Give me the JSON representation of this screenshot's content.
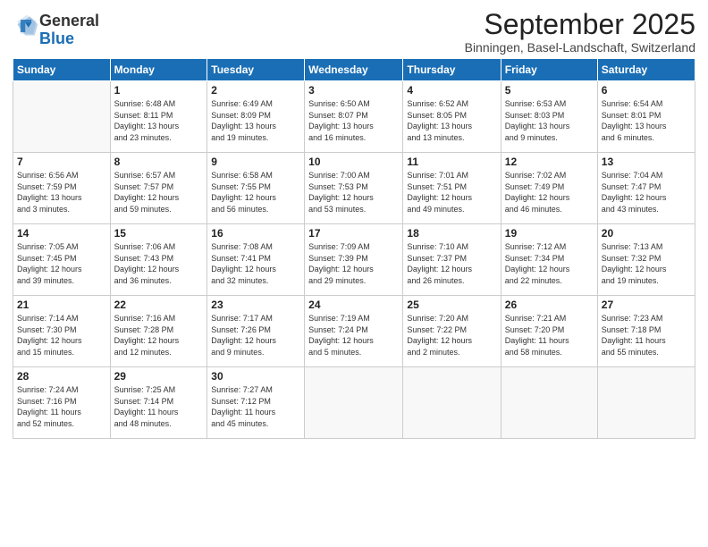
{
  "logo": {
    "text_general": "General",
    "text_blue": "Blue"
  },
  "title": "September 2025",
  "subtitle": "Binningen, Basel-Landschaft, Switzerland",
  "days_of_week": [
    "Sunday",
    "Monday",
    "Tuesday",
    "Wednesday",
    "Thursday",
    "Friday",
    "Saturday"
  ],
  "weeks": [
    [
      {
        "day": "",
        "info": ""
      },
      {
        "day": "1",
        "info": "Sunrise: 6:48 AM\nSunset: 8:11 PM\nDaylight: 13 hours\nand 23 minutes."
      },
      {
        "day": "2",
        "info": "Sunrise: 6:49 AM\nSunset: 8:09 PM\nDaylight: 13 hours\nand 19 minutes."
      },
      {
        "day": "3",
        "info": "Sunrise: 6:50 AM\nSunset: 8:07 PM\nDaylight: 13 hours\nand 16 minutes."
      },
      {
        "day": "4",
        "info": "Sunrise: 6:52 AM\nSunset: 8:05 PM\nDaylight: 13 hours\nand 13 minutes."
      },
      {
        "day": "5",
        "info": "Sunrise: 6:53 AM\nSunset: 8:03 PM\nDaylight: 13 hours\nand 9 minutes."
      },
      {
        "day": "6",
        "info": "Sunrise: 6:54 AM\nSunset: 8:01 PM\nDaylight: 13 hours\nand 6 minutes."
      }
    ],
    [
      {
        "day": "7",
        "info": "Sunrise: 6:56 AM\nSunset: 7:59 PM\nDaylight: 13 hours\nand 3 minutes."
      },
      {
        "day": "8",
        "info": "Sunrise: 6:57 AM\nSunset: 7:57 PM\nDaylight: 12 hours\nand 59 minutes."
      },
      {
        "day": "9",
        "info": "Sunrise: 6:58 AM\nSunset: 7:55 PM\nDaylight: 12 hours\nand 56 minutes."
      },
      {
        "day": "10",
        "info": "Sunrise: 7:00 AM\nSunset: 7:53 PM\nDaylight: 12 hours\nand 53 minutes."
      },
      {
        "day": "11",
        "info": "Sunrise: 7:01 AM\nSunset: 7:51 PM\nDaylight: 12 hours\nand 49 minutes."
      },
      {
        "day": "12",
        "info": "Sunrise: 7:02 AM\nSunset: 7:49 PM\nDaylight: 12 hours\nand 46 minutes."
      },
      {
        "day": "13",
        "info": "Sunrise: 7:04 AM\nSunset: 7:47 PM\nDaylight: 12 hours\nand 43 minutes."
      }
    ],
    [
      {
        "day": "14",
        "info": "Sunrise: 7:05 AM\nSunset: 7:45 PM\nDaylight: 12 hours\nand 39 minutes."
      },
      {
        "day": "15",
        "info": "Sunrise: 7:06 AM\nSunset: 7:43 PM\nDaylight: 12 hours\nand 36 minutes."
      },
      {
        "day": "16",
        "info": "Sunrise: 7:08 AM\nSunset: 7:41 PM\nDaylight: 12 hours\nand 32 minutes."
      },
      {
        "day": "17",
        "info": "Sunrise: 7:09 AM\nSunset: 7:39 PM\nDaylight: 12 hours\nand 29 minutes."
      },
      {
        "day": "18",
        "info": "Sunrise: 7:10 AM\nSunset: 7:37 PM\nDaylight: 12 hours\nand 26 minutes."
      },
      {
        "day": "19",
        "info": "Sunrise: 7:12 AM\nSunset: 7:34 PM\nDaylight: 12 hours\nand 22 minutes."
      },
      {
        "day": "20",
        "info": "Sunrise: 7:13 AM\nSunset: 7:32 PM\nDaylight: 12 hours\nand 19 minutes."
      }
    ],
    [
      {
        "day": "21",
        "info": "Sunrise: 7:14 AM\nSunset: 7:30 PM\nDaylight: 12 hours\nand 15 minutes."
      },
      {
        "day": "22",
        "info": "Sunrise: 7:16 AM\nSunset: 7:28 PM\nDaylight: 12 hours\nand 12 minutes."
      },
      {
        "day": "23",
        "info": "Sunrise: 7:17 AM\nSunset: 7:26 PM\nDaylight: 12 hours\nand 9 minutes."
      },
      {
        "day": "24",
        "info": "Sunrise: 7:19 AM\nSunset: 7:24 PM\nDaylight: 12 hours\nand 5 minutes."
      },
      {
        "day": "25",
        "info": "Sunrise: 7:20 AM\nSunset: 7:22 PM\nDaylight: 12 hours\nand 2 minutes."
      },
      {
        "day": "26",
        "info": "Sunrise: 7:21 AM\nSunset: 7:20 PM\nDaylight: 11 hours\nand 58 minutes."
      },
      {
        "day": "27",
        "info": "Sunrise: 7:23 AM\nSunset: 7:18 PM\nDaylight: 11 hours\nand 55 minutes."
      }
    ],
    [
      {
        "day": "28",
        "info": "Sunrise: 7:24 AM\nSunset: 7:16 PM\nDaylight: 11 hours\nand 52 minutes."
      },
      {
        "day": "29",
        "info": "Sunrise: 7:25 AM\nSunset: 7:14 PM\nDaylight: 11 hours\nand 48 minutes."
      },
      {
        "day": "30",
        "info": "Sunrise: 7:27 AM\nSunset: 7:12 PM\nDaylight: 11 hours\nand 45 minutes."
      },
      {
        "day": "",
        "info": ""
      },
      {
        "day": "",
        "info": ""
      },
      {
        "day": "",
        "info": ""
      },
      {
        "day": "",
        "info": ""
      }
    ]
  ]
}
